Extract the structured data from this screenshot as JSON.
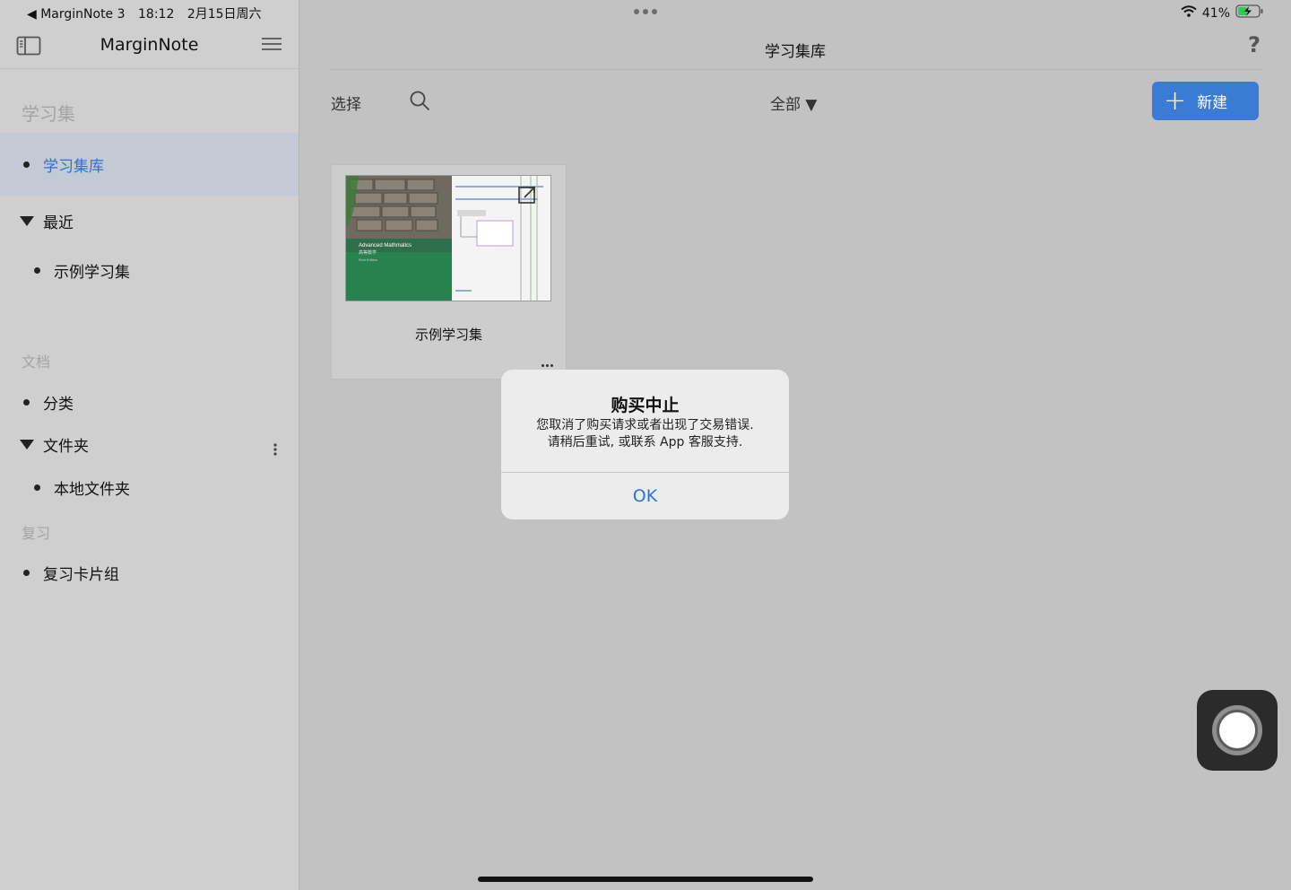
{
  "status_bar": {
    "back_app": "◀ MarginNote 3",
    "time": "18:12",
    "date": "2月15日周六",
    "battery": "41%"
  },
  "sidebar": {
    "title": "MarginNote",
    "section_notebooks": "学习集",
    "active_item": "学习集库",
    "recent_label": "最近",
    "recent_items": [
      "示例学习集"
    ],
    "section_documents": "文档",
    "categories_label": "分类",
    "folders_label": "文件夹",
    "folder_items": [
      "本地文件夹"
    ],
    "section_review": "复习",
    "review_items": [
      "复习卡片组"
    ]
  },
  "main": {
    "title": "学习集库",
    "help": "?",
    "select_label": "选择",
    "filter_label": "全部",
    "filter_arrow": "▼",
    "new_label": "新建",
    "new_plus": "+"
  },
  "card": {
    "title": "示例学习集",
    "cover_title": "Advanced Mathmatics",
    "cover_subtitle": "高等数学",
    "cover_edition": "First Edition"
  },
  "dialog": {
    "title": "购买中止",
    "message_line1": "您取消了购买请求或者出现了交易错误.",
    "message_line2": "请稍后重试, 或联系 App 客服支持.",
    "ok": "OK"
  },
  "colors": {
    "accent": "#3a7bd5",
    "active_text": "#2f6fd1",
    "sidebar_bg": "#cfcfcf",
    "main_bg": "#c2c2c2",
    "battery_green": "#34c759"
  }
}
